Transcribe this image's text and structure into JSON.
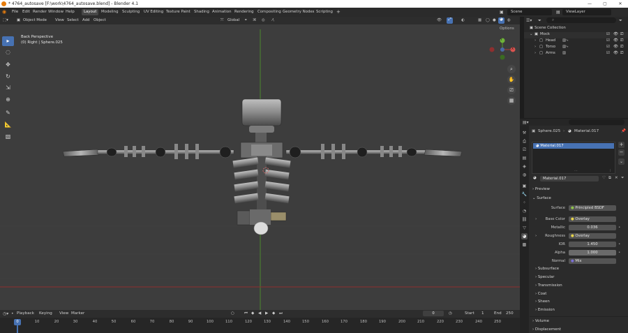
{
  "window": {
    "title": "* 4764_autosave [F:\\work\\4764_autosave.blend] - Blender 4.1",
    "minimize": "—",
    "maximize": "▢",
    "close": "✕"
  },
  "menu": {
    "items": [
      "File",
      "Edit",
      "Render",
      "Window",
      "Help"
    ],
    "workspaces": [
      "Layout",
      "Modeling",
      "Sculpting",
      "UV Editing",
      "Texture Paint",
      "Shading",
      "Animation",
      "Rendering",
      "Compositing",
      "Geometry Nodes",
      "Scripting"
    ],
    "active_workspace": "Layout",
    "add_workspace": "+",
    "scene_label": "Scene",
    "viewlayer_label": "ViewLayer"
  },
  "viewport": {
    "mode": "Object Mode",
    "header_menus": [
      "View",
      "Select",
      "Add",
      "Object"
    ],
    "transform_orientation": "Global",
    "options_label": "Options",
    "view_name": "Back Perspective",
    "object_info": "(0) Right | Sphere.025",
    "gizmo_axes": {
      "x": "X",
      "y": "Y",
      "z": "Z"
    },
    "colors": {
      "bg": "#3d3d3d",
      "x_axis": "#b23a3a",
      "y_axis": "#4f9a2a",
      "accent": "#4772b3"
    }
  },
  "outliner": {
    "search_placeholder": "",
    "root": "Scene Collection",
    "collection": "Mock",
    "children": [
      "Head",
      "Torso",
      "Arms"
    ]
  },
  "properties": {
    "object_name": "Sphere.025",
    "material_name": "Material.017",
    "material_slot": "Material.017",
    "panels": {
      "preview": "Preview",
      "surface": "Surface"
    },
    "fields": [
      {
        "label": "Surface",
        "value": "Principled BSDF"
      },
      {
        "label": "Base Color",
        "value": "Overlay"
      },
      {
        "label": "Metallic",
        "value": "0.036"
      },
      {
        "label": "Roughness",
        "value": "Overlay"
      },
      {
        "label": "IOR",
        "value": "1.450"
      },
      {
        "label": "Alpha",
        "value": "1.000"
      },
      {
        "label": "Normal",
        "value": "Mix"
      }
    ],
    "subsections": [
      "Subsurface",
      "Specular",
      "Transmission",
      "Coat",
      "Sheen",
      "Emission"
    ],
    "bottom_sections": [
      "Volume",
      "Displacement"
    ]
  },
  "timeline": {
    "menus": [
      "Playback",
      "Keying",
      "View",
      "Marker"
    ],
    "current_frame": "0",
    "start_label": "Start",
    "start_value": "1",
    "end_label": "End",
    "end_value": "250",
    "frame_marker": "0",
    "ticks": [
      "10",
      "20",
      "30",
      "40",
      "50",
      "60",
      "70",
      "80",
      "90",
      "100",
      "110",
      "120",
      "130",
      "140",
      "150",
      "160",
      "170",
      "180",
      "190",
      "200",
      "210",
      "220",
      "230",
      "240",
      "250"
    ]
  }
}
